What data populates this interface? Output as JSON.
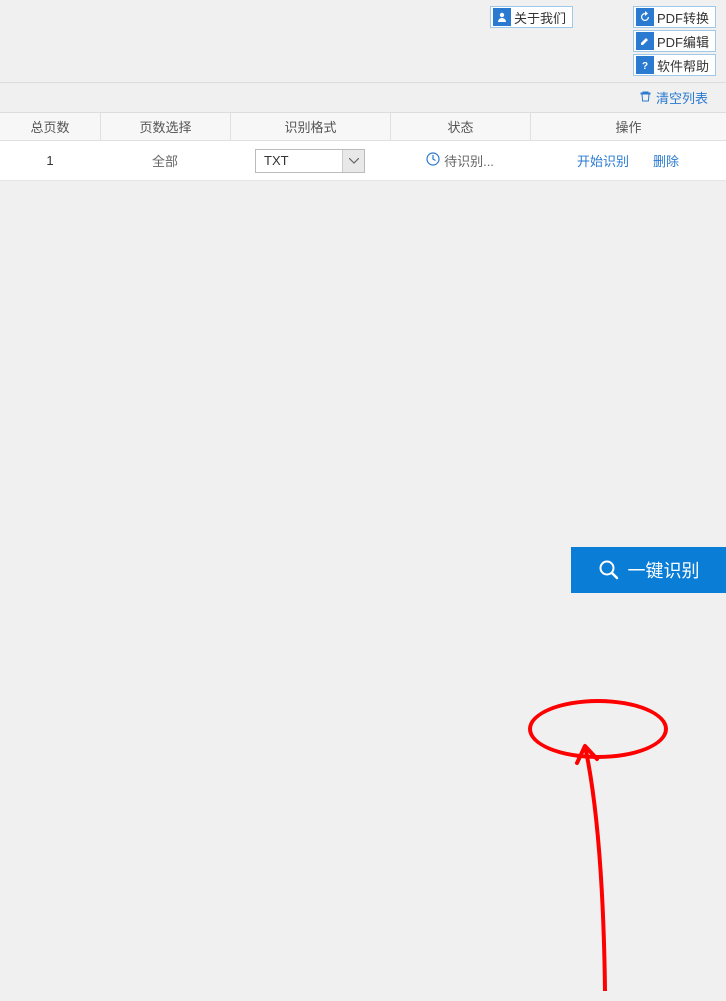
{
  "top_links": {
    "about": "关于我们",
    "pdf_convert": "PDF转换",
    "pdf_edit": "PDF编辑",
    "help": "软件帮助"
  },
  "clear_list": "清空列表",
  "headers": {
    "pages": "总页数",
    "page_select": "页数选择",
    "format": "识别格式",
    "status": "状态",
    "action": "操作"
  },
  "row": {
    "pages": "1",
    "page_select": "全部",
    "format": "TXT",
    "status": "待识别...",
    "start": "开始识别",
    "delete": "删除"
  },
  "bottom_button": "一键识别"
}
